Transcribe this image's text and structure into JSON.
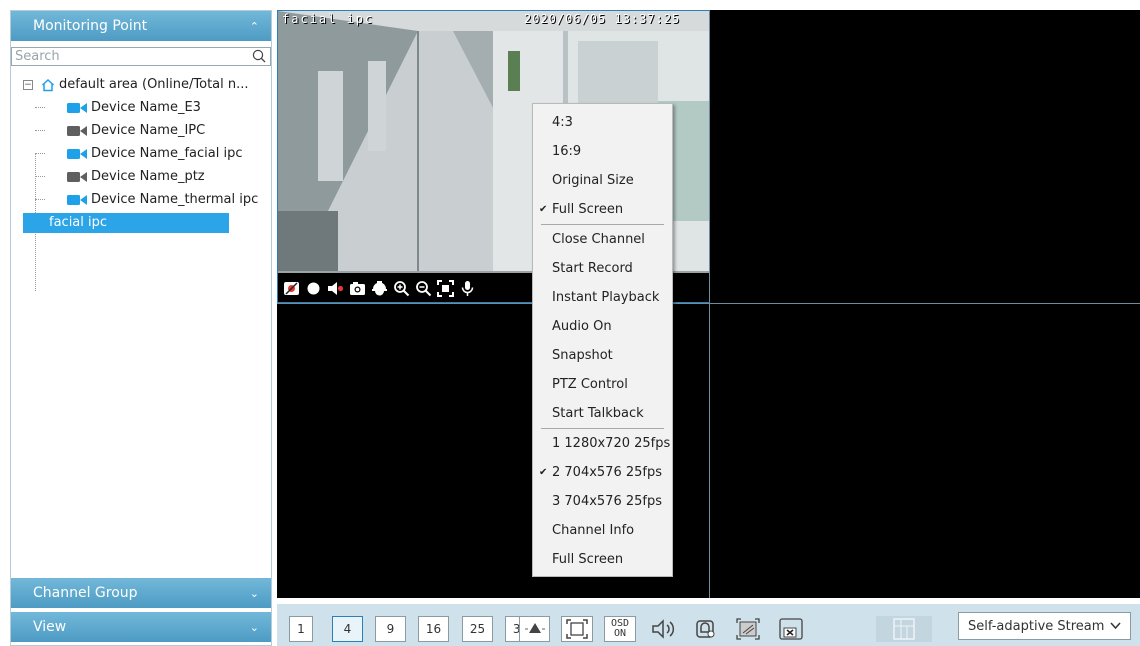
{
  "sidebar": {
    "monitoring_title": "Monitoring Point",
    "search_placeholder": "Search",
    "tree": {
      "root_label": "default area (Online/Total n...",
      "devices": [
        {
          "label": "Device Name_E3",
          "online": true
        },
        {
          "label": "Device Name_IPC",
          "online": false
        },
        {
          "label": "Device Name_facial ipc",
          "online": true
        },
        {
          "label": "Device Name_ptz",
          "online": false
        },
        {
          "label": "Device Name_thermal ipc",
          "online": true
        }
      ],
      "selected_channel": "facial ipc"
    },
    "channel_group_title": "Channel Group",
    "view_title": "View"
  },
  "video": {
    "channel_name": "facial ipc",
    "timestamp": "2020/06/05 13:37:25"
  },
  "context_menu": {
    "aspect": [
      {
        "label": "4:3",
        "checked": false
      },
      {
        "label": "16:9",
        "checked": false
      },
      {
        "label": "Original Size",
        "checked": false
      },
      {
        "label": "Full Screen",
        "checked": true
      }
    ],
    "actions": [
      "Close Channel",
      "Start Record",
      "Instant Playback",
      "Audio On",
      "Snapshot",
      "PTZ Control",
      "Start Talkback"
    ],
    "streams": [
      {
        "label": "1 1280x720 25fps",
        "checked": false
      },
      {
        "label": "2 704x576 25fps",
        "checked": true
      },
      {
        "label": "3 704x576 25fps",
        "checked": false
      }
    ],
    "tail": [
      "Channel Info",
      "Full Screen"
    ]
  },
  "toolbar": {
    "layouts": [
      "1",
      "4",
      "9",
      "16",
      "25",
      "36"
    ],
    "active_layout": "4",
    "osd_label_top": "OSD",
    "osd_label_bottom": "ON",
    "stream_select": "Self-adaptive Stream"
  },
  "colors": {
    "header": "#5aa7cf",
    "selection": "#2ba4e8",
    "camera_online": "#1ea1e8",
    "camera_offline": "#5f5f5f",
    "toolbar_bg": "#cfe2ec"
  }
}
